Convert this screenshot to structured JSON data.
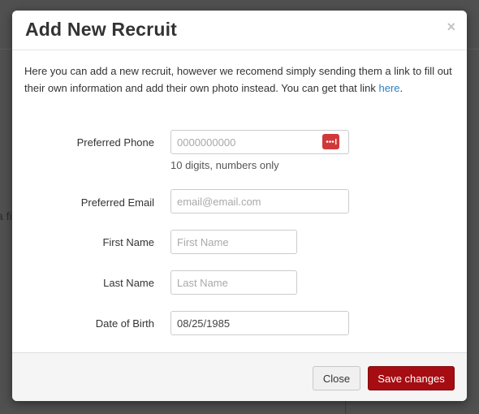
{
  "background": {
    "fragment_text": "a fi"
  },
  "modal": {
    "title": "Add New Recruit",
    "close_glyph": "×",
    "intro_text": "Here you can add a new recruit, however we recomend simply sending them a link to fill out their own information and add their own photo instead. You can get that link ",
    "intro_link": "here",
    "intro_end": "."
  },
  "form": {
    "phone": {
      "label": "Preferred Phone",
      "value": "",
      "placeholder": "0000000000",
      "help": "10 digits, numbers only",
      "autofill_icon": "password-keychain-icon"
    },
    "email": {
      "label": "Preferred Email",
      "value": "",
      "placeholder": "email@email.com"
    },
    "first_name": {
      "label": "First Name",
      "value": "",
      "placeholder": "First Name"
    },
    "last_name": {
      "label": "Last Name",
      "value": "",
      "placeholder": "Last Name"
    },
    "dob": {
      "label": "Date of Birth",
      "value": "08/25/1985",
      "placeholder": ""
    }
  },
  "footer": {
    "close_label": "Close",
    "save_label": "Save changes"
  },
  "colors": {
    "link": "#2a7fc1",
    "primary_button": "#a50d12",
    "autofill_icon": "#d0393b"
  }
}
